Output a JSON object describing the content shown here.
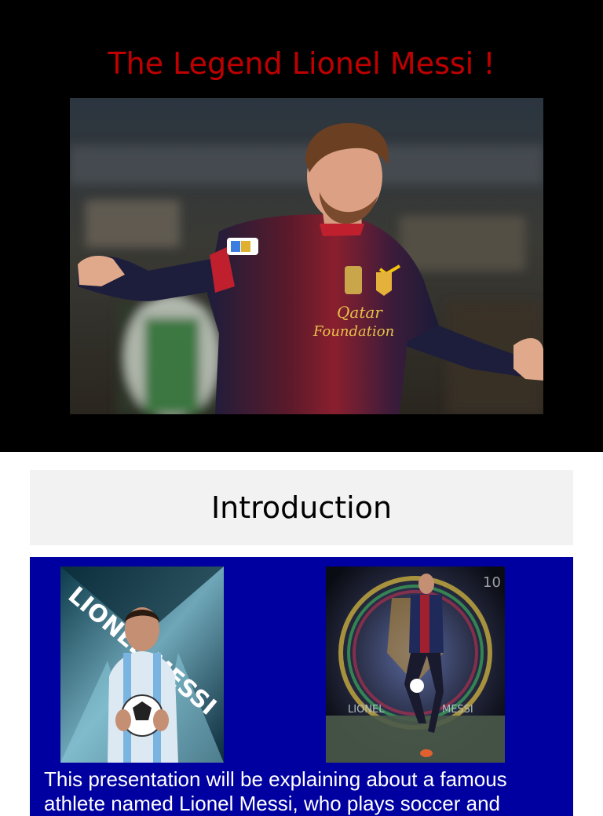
{
  "slide1": {
    "title": "The Legend Lionel Messi !",
    "background": "#000000",
    "title_color": "#c00000",
    "photo_alt": "Lionel Messi celebrating in Barcelona jersey",
    "jersey_text_line1": "Qatar",
    "jersey_text_line2": "Foundation"
  },
  "slide2": {
    "title": "Introduction",
    "header_background": "#f2f2f2",
    "body_background": "#0000a0",
    "left_photo_alt": "Messi in Argentina jersey holding a ball",
    "left_photo_text": "LIONEL MESSI",
    "right_photo_alt": "Messi in Barcelona kit with crest background",
    "right_photo_text_left": "LIONEL",
    "right_photo_text_right": "MESSI",
    "right_photo_number": "10",
    "body_text": "This presentation will be explaining about a famous athlete named Lionel Messi, who plays soccer and"
  }
}
